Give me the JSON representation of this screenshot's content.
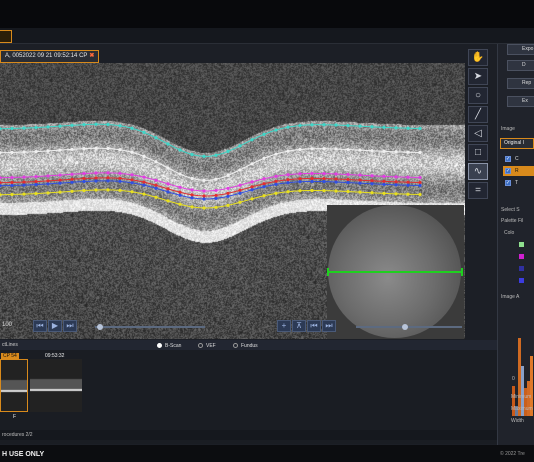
{
  "tab": {
    "label": ""
  },
  "image_title": "A, 0052022 09 21 09:52:14 CP",
  "image_close": "✖",
  "viewer": {
    "scale_label": "100"
  },
  "toolbar": {
    "tools": [
      {
        "name": "hand-tool-icon",
        "glyph": "✋"
      },
      {
        "name": "pointer-tool-icon",
        "glyph": "➤"
      },
      {
        "name": "ellipse-tool-icon",
        "glyph": "○"
      },
      {
        "name": "line-tool-icon",
        "glyph": "╱"
      },
      {
        "name": "polygon-tool-icon",
        "glyph": "◁"
      },
      {
        "name": "rectangle-tool-icon",
        "glyph": "□"
      },
      {
        "name": "freehand-tool-icon",
        "glyph": "∿"
      },
      {
        "name": "equal-tool-icon",
        "glyph": "="
      }
    ]
  },
  "right_panel": {
    "buttons": [
      "Expo",
      "D",
      "Rep",
      "Ex"
    ],
    "image_section": "Image",
    "original_tab": "Original I",
    "layers": [
      {
        "label": "C",
        "checked": "✓"
      },
      {
        "label": "R",
        "checked": "✓"
      },
      {
        "label": "T",
        "checked": "✓"
      }
    ],
    "select_section": "Select S",
    "palette_label": "Palette Fil",
    "color_col": "Colo",
    "palette_colors": [
      "#8fe08f",
      "#d020d0",
      "#3030a0",
      "#3c3ce0"
    ],
    "adjust_section": "Image A",
    "min_label": "Minimum",
    "max_label": "Maximum",
    "width_label": "Width",
    "hist_tick": "0"
  },
  "bottom": {
    "header_left": "ctLines",
    "radios": [
      {
        "label": "B-Scan",
        "on": true
      },
      {
        "label": "VEF",
        "on": false
      },
      {
        "label": "Fundus",
        "on": false
      }
    ],
    "thumbs": [
      {
        "caption": "CP 54",
        "sub": "F"
      },
      {
        "caption": "09:53:32",
        "sub": ""
      }
    ],
    "procedures": "rocedures 2/2"
  },
  "status": {
    "text": "H USE ONLY"
  },
  "copyright": "© 2022 Tre",
  "colors": {
    "accent": "#d88a1c",
    "layer_cyan": "#3fd6c8",
    "layer_white": "#f0f0f0",
    "layer_magenta": "#e040e0",
    "layer_red": "#e03030",
    "layer_blue": "#3050e0",
    "layer_yellow": "#e8e020"
  }
}
